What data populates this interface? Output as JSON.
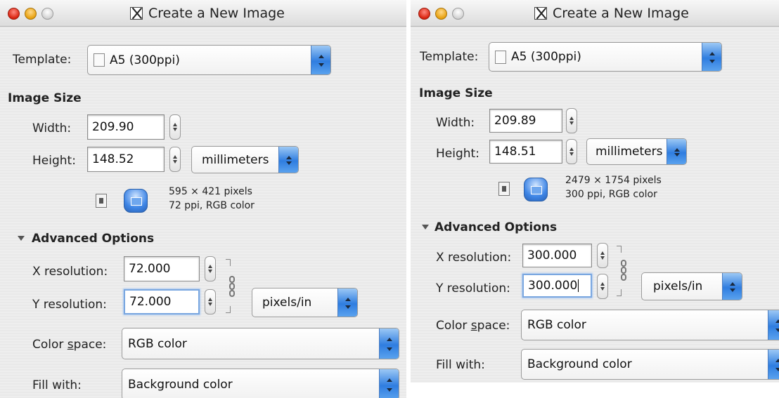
{
  "left": {
    "title": "Create a New Image",
    "template": {
      "label": "Template:",
      "value": "A5 (300ppi)"
    },
    "image_size": {
      "heading": "Image Size",
      "width_label": "Width:",
      "width": "209.90",
      "height_label": "Height:",
      "height": "148.52",
      "unit": "millimeters",
      "info_line1": "595 × 421 pixels",
      "info_line2": "72 ppi, RGB color"
    },
    "advanced": {
      "heading": "Advanced Options",
      "x_res_label": "X resolution:",
      "x_res": "72.000",
      "y_res_label": "Y resolution:",
      "y_res": "72.000",
      "res_unit": "pixels/in",
      "color_space_label": "Color space:",
      "color_space": "RGB color",
      "fill_label": "Fill with:",
      "fill": "Background color"
    }
  },
  "right": {
    "title": "Create a New Image",
    "template": {
      "label": "Template:",
      "value": "A5 (300ppi)"
    },
    "image_size": {
      "heading": "Image Size",
      "width_label": "Width:",
      "width": "209.89",
      "height_label": "Height:",
      "height": "148.51",
      "unit": "millimeters",
      "info_line1": "2479 × 1754 pixels",
      "info_line2": "300 ppi, RGB color"
    },
    "advanced": {
      "heading": "Advanced Options",
      "x_res_label": "X resolution:",
      "x_res": "300.000",
      "y_res_label": "Y resolution:",
      "y_res": "300.000",
      "res_unit": "pixels/in",
      "color_space_label": "Color space:",
      "color_space": "RGB color",
      "fill_label": "Fill with:",
      "fill": "Background color"
    }
  },
  "colors": {
    "accent": "#2f7de0",
    "close": "#d9230f",
    "minimize": "#e8a10f",
    "window_bg": "#ececec"
  },
  "icons": [
    "close-icon",
    "minimize-icon",
    "zoom-icon",
    "x11-icon",
    "document-icon",
    "portrait-icon",
    "landscape-icon",
    "chain-icon",
    "disclosure-triangle-icon"
  ]
}
